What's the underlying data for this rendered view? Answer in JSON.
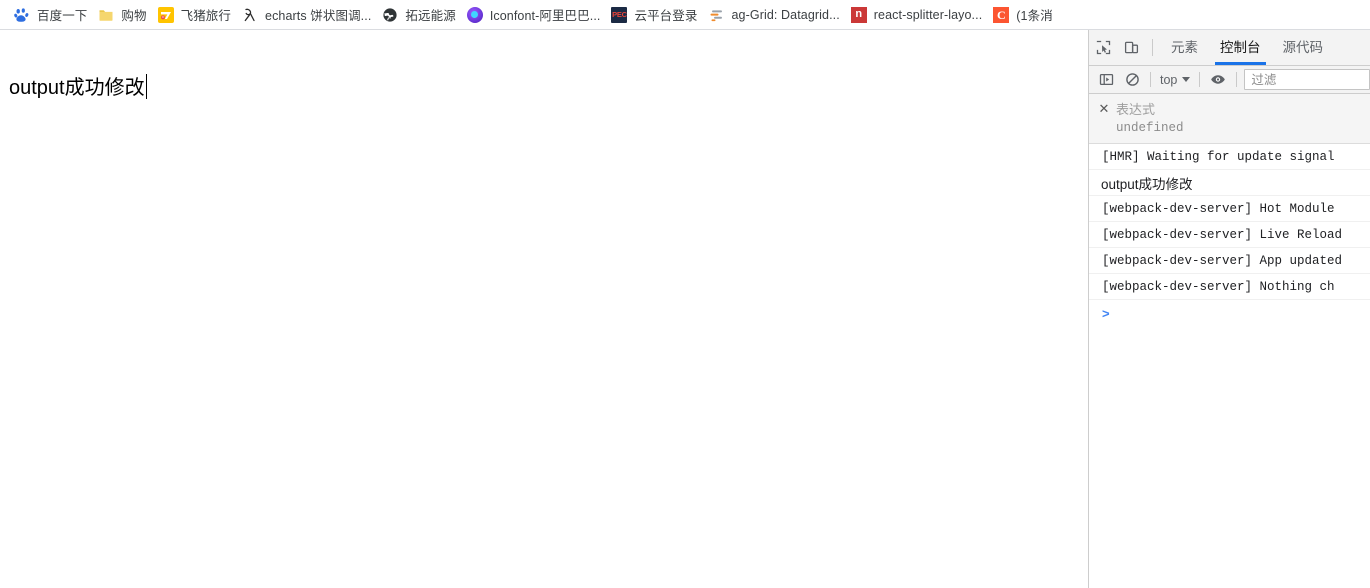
{
  "bookmarks": [
    {
      "label": "百度一下",
      "icon": "baidu-paw-icon"
    },
    {
      "label": "购物",
      "icon": "folder-icon"
    },
    {
      "label": "飞猪旅行",
      "icon": "fliggy-icon"
    },
    {
      "label": "echarts 饼状图调...",
      "icon": "echarts-icon"
    },
    {
      "label": "拓远能源",
      "icon": "globe-icon"
    },
    {
      "label": "Iconfont-阿里巴巴...",
      "icon": "iconfont-icon"
    },
    {
      "label": "云平台登录",
      "icon": "pec-icon"
    },
    {
      "label": "ag-Grid: Datagrid...",
      "icon": "ag-grid-icon"
    },
    {
      "label": "react-splitter-layo...",
      "icon": "npm-icon"
    },
    {
      "label": "(1条消",
      "icon": "csdn-icon"
    }
  ],
  "page": {
    "text": "output成功修改"
  },
  "devtools": {
    "tabs": [
      {
        "label": "元素",
        "active": false
      },
      {
        "label": "控制台",
        "active": true
      },
      {
        "label": "源代码",
        "active": false
      }
    ],
    "console_toolbar": {
      "context": "top",
      "filter_placeholder": "过滤",
      "filter_value": ""
    },
    "live_expression": {
      "name": "表达式",
      "value": "undefined"
    },
    "messages": [
      {
        "text": "[HMR] Waiting for update signal",
        "cjk": false
      },
      {
        "text": "output成功修改",
        "cjk": true
      },
      {
        "text": "[webpack-dev-server] Hot Module",
        "cjk": false
      },
      {
        "text": "[webpack-dev-server] Live Reload",
        "cjk": false
      },
      {
        "text": "[webpack-dev-server] App updated",
        "cjk": false
      },
      {
        "text": "[webpack-dev-server] Nothing ch",
        "cjk": false
      }
    ],
    "prompt": ">"
  },
  "colors": {
    "accent": "#1a73e8",
    "prompt": "#4285f4",
    "toolbar_bg": "#f3f3f3",
    "border": "#cdcdcd"
  }
}
